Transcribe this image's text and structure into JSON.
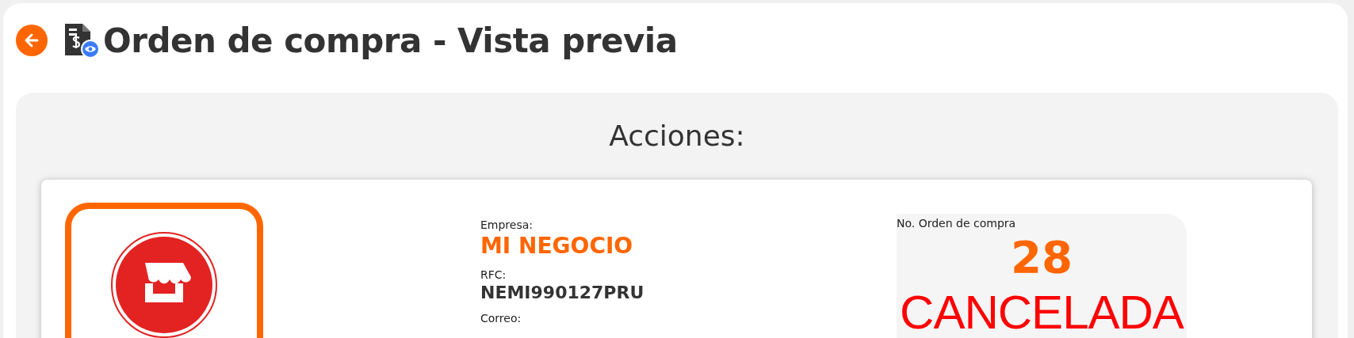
{
  "header": {
    "title": "Orden de compra - Vista previa"
  },
  "actions": {
    "title": "Acciones:"
  },
  "company": {
    "fields": [
      {
        "label": "Empresa:",
        "value": "MI NEGOCIO",
        "kind": "highlight"
      },
      {
        "label": "RFC:",
        "value": "NEMI990127PRU",
        "kind": "plain"
      },
      {
        "label": "Correo:"
      }
    ]
  },
  "order": {
    "label": "No. Orden de compra",
    "number": "28",
    "status": {
      "label": "CANCELADA",
      "kind": "cancelled"
    }
  }
}
